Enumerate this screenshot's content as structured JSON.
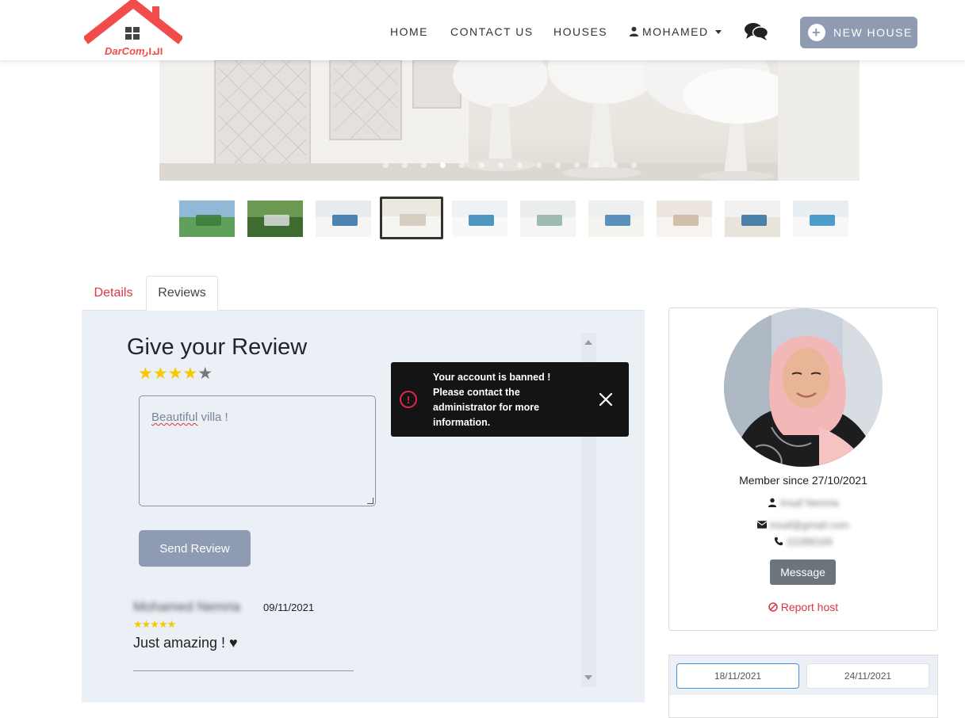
{
  "brand": {
    "logo_text_latin": "DarCom",
    "logo_text_arabic": "الدار",
    "logo_color": "#f24b4b"
  },
  "nav": {
    "home": "HOME",
    "contact": "CONTACT US",
    "houses": "HOUSES",
    "user": "MOHAMED",
    "new_house": "NEW HOUSE"
  },
  "carousel": {
    "dot_count": 14,
    "active_index": 3
  },
  "thumbnails": {
    "count": 10,
    "active_index": 3
  },
  "tabs": {
    "details": "Details",
    "reviews": "Reviews",
    "active": "Reviews"
  },
  "review_form": {
    "title": "Give your Review",
    "rating": 4,
    "max_rating": 5,
    "text_word1": "Beautiful",
    "text_rest": " villa !",
    "send_label": "Send Review"
  },
  "reviews": [
    {
      "author": "Mohamed Nemria",
      "date": "09/11/2021",
      "stars": "★★★★★",
      "text": "Just amazing ! ♥"
    }
  ],
  "toast": {
    "message": "Your account is banned ! Please contact the administrator for more information.",
    "type": "error",
    "accent": "#e3254a"
  },
  "host": {
    "member_since": "Member since 27/10/2021",
    "name": "Insaf Nemria",
    "email": "insaf@gmail.com",
    "phone": "22289169",
    "message_label": "Message",
    "report_label": "Report host"
  },
  "booking": {
    "date_from": "18/11/2021",
    "date_to": "24/11/2021"
  },
  "colors": {
    "accent_button": "#8e9bb2",
    "danger": "#dc3545",
    "panel_bg": "#ebeff6",
    "star": "#f7c900"
  }
}
